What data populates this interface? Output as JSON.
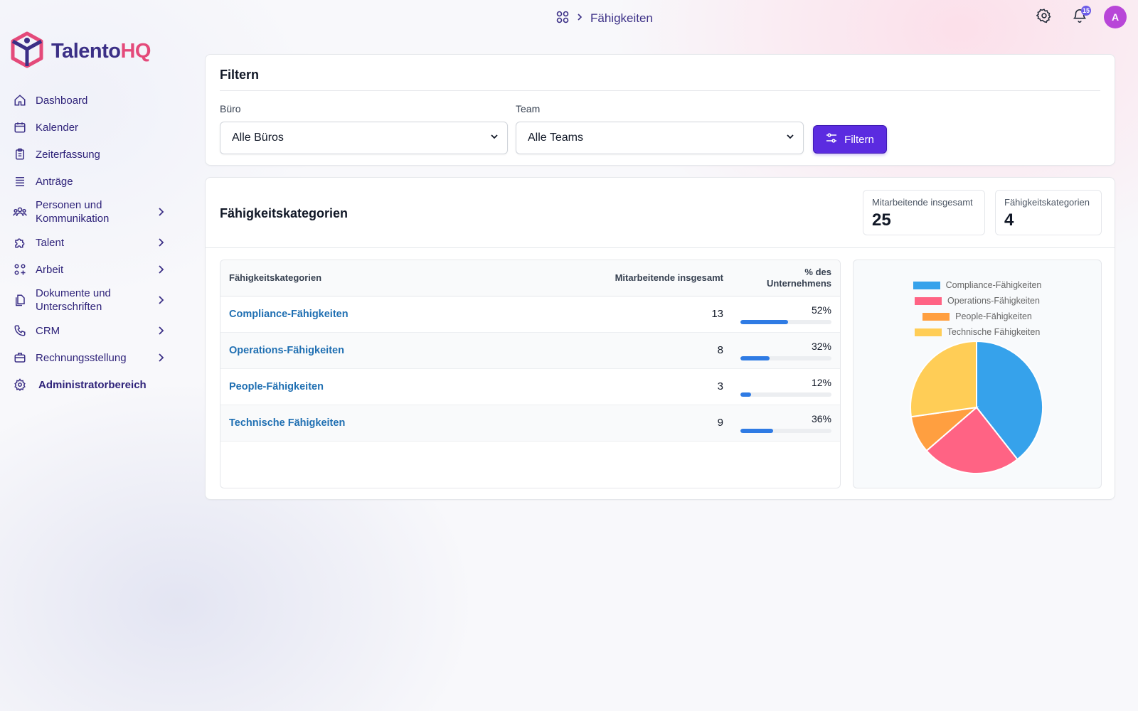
{
  "breadcrumb": {
    "current": "Fähigkeiten"
  },
  "topbar": {
    "notification_count": "15",
    "avatar_initial": "A"
  },
  "brand": {
    "part1": "Talento",
    "part2": "HQ",
    "primary_color": "#3b2f86",
    "accent_color": "#e44a7a"
  },
  "sidebar": {
    "items": [
      {
        "label": "Dashboard",
        "icon": "home-icon"
      },
      {
        "label": "Kalender",
        "icon": "calendar-icon"
      },
      {
        "label": "Zeiterfassung",
        "icon": "clipboard-icon"
      },
      {
        "label": "Anträge",
        "icon": "list-icon"
      },
      {
        "label": "Personen und Kommunikation",
        "icon": "people-icon",
        "expandable": true
      },
      {
        "label": "Talent",
        "icon": "puzzle-icon",
        "expandable": true
      },
      {
        "label": "Arbeit",
        "icon": "grid-plus-icon",
        "expandable": true
      },
      {
        "label": "Dokumente und Unterschriften",
        "icon": "documents-icon",
        "expandable": true
      },
      {
        "label": "CRM",
        "icon": "phone-icon",
        "expandable": true
      },
      {
        "label": "Rechnungsstellung",
        "icon": "briefcase-icon",
        "expandable": true
      },
      {
        "label": "Administratorbereich",
        "icon": "gear-icon"
      }
    ]
  },
  "filter": {
    "title": "Filtern",
    "office_label": "Büro",
    "office_value": "Alle Büros",
    "team_label": "Team",
    "team_value": "Alle Teams",
    "button_label": "Filtern"
  },
  "skills": {
    "title": "Fähigkeitskategorien",
    "stats": [
      {
        "label": "Mitarbeitende insgesamt",
        "value": "25"
      },
      {
        "label": "Fähigkeitskategorien",
        "value": "4"
      }
    ],
    "table": {
      "headers": [
        "Fähigkeitskategorien",
        "Mitarbeitende insgesamt",
        "% des Unternehmens"
      ],
      "rows": [
        {
          "category": "Compliance-Fähigkeiten",
          "count": "13",
          "percent": "52%",
          "fraction": 0.52
        },
        {
          "category": "Operations-Fähigkeiten",
          "count": "8",
          "percent": "32%",
          "fraction": 0.32
        },
        {
          "category": "People-Fähigkeiten",
          "count": "3",
          "percent": "12%",
          "fraction": 0.12
        },
        {
          "category": "Technische Fähigkeiten",
          "count": "9",
          "percent": "36%",
          "fraction": 0.36
        }
      ]
    }
  },
  "chart_data": {
    "type": "pie",
    "legend_position": "top",
    "categories": [
      "Compliance-Fähigkeiten",
      "Operations-Fähigkeiten",
      "People-Fähigkeiten",
      "Technische Fähigkeiten"
    ],
    "values": [
      13,
      8,
      3,
      9
    ],
    "colors": [
      "#36a2eb",
      "#ff6384",
      "#ff9f40",
      "#ffcd56"
    ]
  },
  "colors": {
    "primary_button": "#5b2be0",
    "link": "#1f6fb2",
    "progress": "#2f7be4"
  }
}
